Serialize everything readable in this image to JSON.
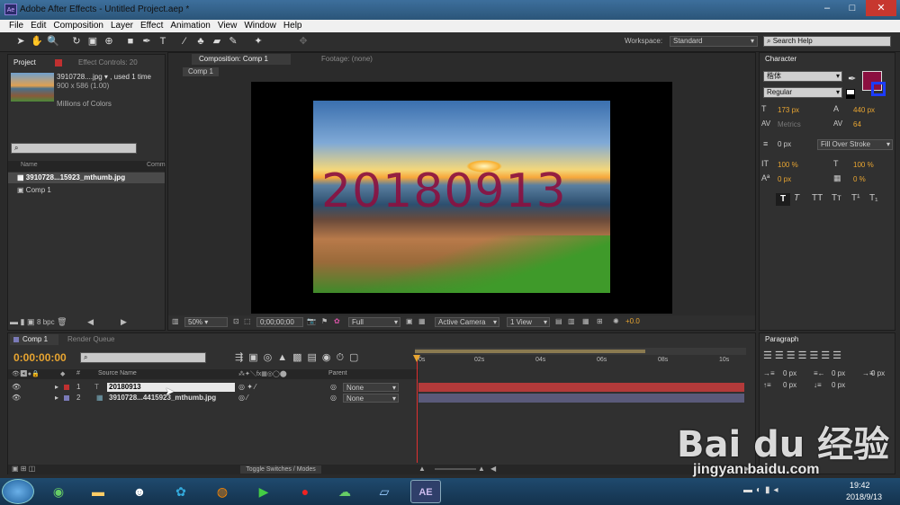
{
  "window": {
    "title": "Adobe After Effects - Untitled Project.aep *",
    "app_icon": "Ae",
    "min": "–",
    "max": "□",
    "close": "✕"
  },
  "menu": [
    "File",
    "Edit",
    "Composition",
    "Layer",
    "Effect",
    "Animation",
    "View",
    "Window",
    "Help"
  ],
  "workspace": {
    "label": "Workspace:",
    "value": "Standard"
  },
  "search_help": "Search Help",
  "project_panel": {
    "tab": "Project",
    "effect_controls_tab": "Effect Controls: 20",
    "item_name": "3910728....jpg ▾ , used 1 time",
    "item_dims": "900 x 586 (1.00)",
    "item_colors": "Millions of Colors",
    "col_name": "Name",
    "col_comment": "Comm",
    "items": [
      {
        "name": "3910728...15923_mthumb.jpg",
        "selected": true
      },
      {
        "name": "Comp 1",
        "selected": false
      }
    ],
    "bpc": "8 bpc"
  },
  "comp_panel": {
    "tab": "Composition: Comp 1",
    "footage_tab": "Footage: (none)",
    "subtab": "Comp 1",
    "overlay_text": "20180913",
    "zoom": "50%",
    "timecode": "0;00;00;00",
    "quality": "Full",
    "camera": "Active Camera",
    "view": "1 View",
    "exposure": "+0.0"
  },
  "character_panel": {
    "tab": "Character",
    "font": "楷体",
    "style": "Regular",
    "fill_color": "#8b1040",
    "size": "173 px",
    "leading": "440 px",
    "kerning": "Metrics",
    "tracking": "64",
    "stroke_width": "0 px",
    "stroke_mode": "Fill Over Stroke",
    "vscale": "100 %",
    "hscale": "100 %",
    "baseline": "0 px",
    "tsume": "0 %",
    "style_buttons": [
      "T",
      "T",
      "TT",
      "Tт",
      "T¹",
      "T₁"
    ]
  },
  "paragraph_panel": {
    "tab": "Paragraph",
    "v1": "0 px",
    "v2": "0 px",
    "v3": "0 px",
    "v4": "0 px",
    "v5": "0 px"
  },
  "timeline": {
    "tab": "Comp 1",
    "render_tab": "Render Queue",
    "timecode": "0:00:00:00",
    "col_source": "Source Name",
    "col_parent": "Parent",
    "ticks": [
      "0s",
      "02s",
      "04s",
      "06s",
      "08s",
      "10s"
    ],
    "layers": [
      {
        "num": "1",
        "name": "20180913",
        "parent": "None",
        "color": "#c03030"
      },
      {
        "num": "2",
        "name": "3910728...4415923_mthumb.jpg",
        "parent": "None",
        "color": "#7a7ab8"
      }
    ],
    "toggle_label": "Toggle Switches / Modes"
  },
  "watermark": {
    "logo": "Bai du 经验",
    "url": "jingyan.baidu.com"
  },
  "taskbar": {
    "time": "19:42",
    "date": "2018/9/13",
    "ae_label": "AE"
  }
}
